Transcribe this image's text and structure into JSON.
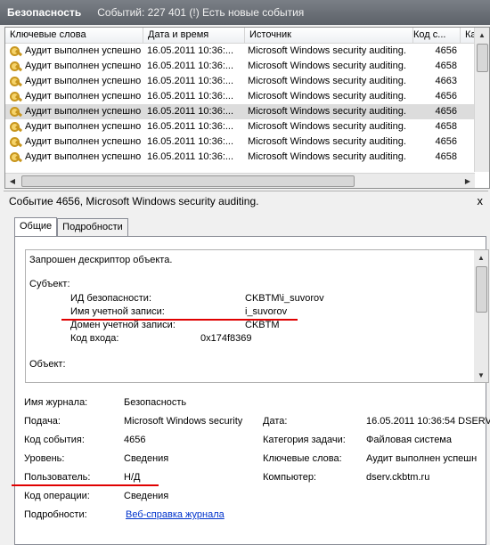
{
  "window": {
    "title": "Безопасность",
    "events_info": "Событий: 227 401 (!) Есть новые события"
  },
  "columns": [
    "Ключевые слова",
    "Дата и время",
    "Источник",
    "Код с...",
    "Ка"
  ],
  "rows": [
    {
      "keyword": "Аудит выполнен успешно",
      "date": "16.05.2011 10:36:...",
      "source": "Microsoft Windows security auditing.",
      "code": "4656"
    },
    {
      "keyword": "Аудит выполнен успешно",
      "date": "16.05.2011 10:36:...",
      "source": "Microsoft Windows security auditing.",
      "code": "4658"
    },
    {
      "keyword": "Аудит выполнен успешно",
      "date": "16.05.2011 10:36:...",
      "source": "Microsoft Windows security auditing.",
      "code": "4663"
    },
    {
      "keyword": "Аудит выполнен успешно",
      "date": "16.05.2011 10:36:...",
      "source": "Microsoft Windows security auditing.",
      "code": "4656"
    },
    {
      "keyword": "Аудит выполнен успешно",
      "date": "16.05.2011 10:36:...",
      "source": "Microsoft Windows security auditing.",
      "code": "4656"
    },
    {
      "keyword": "Аудит выполнен успешно",
      "date": "16.05.2011 10:36:...",
      "source": "Microsoft Windows security auditing.",
      "code": "4658"
    },
    {
      "keyword": "Аудит выполнен успешно",
      "date": "16.05.2011 10:36:...",
      "source": "Microsoft Windows security auditing.",
      "code": "4656"
    },
    {
      "keyword": "Аудит выполнен успешно",
      "date": "16.05.2011 10:36:...",
      "source": "Microsoft Windows security auditing.",
      "code": "4658"
    }
  ],
  "selected_row": 4,
  "detail": {
    "title": "Событие 4656, Microsoft Windows security auditing.",
    "close": "x",
    "tabs": [
      "Общие",
      "Подробности"
    ],
    "message": {
      "line1": "Запрошен дескриптор объекта.",
      "subject_label": "Субъект:",
      "sid_label": "ИД безопасности:",
      "sid_value": "CKBTM\\i_suvorov",
      "account_label": "Имя учетной записи:",
      "account_value": "i_suvorov",
      "domain_label": "Домен учетной записи:",
      "domain_value": "CKBTM",
      "logon_label": "Код входа:",
      "logon_value": "0x174f8369",
      "object_label": "Объект:"
    },
    "props": {
      "log_name_label": "Имя журнала:",
      "log_name": "Безопасность",
      "source_label": "Подача:",
      "source": "Microsoft Windows security",
      "date_label": "Дата:",
      "date": "16.05.2011 10:36:54 DSERV",
      "event_id_label": "Код события:",
      "event_id": "4656",
      "task_label": "Категория задачи:",
      "task": "Файловая система",
      "level_label": "Уровень:",
      "level": "Сведения",
      "keywords_label": "Ключевые слова:",
      "keywords": "Аудит выполнен успешн",
      "user_label": "Пользователь:",
      "user": "Н/Д",
      "computer_label": "Компьютер:",
      "computer": "dserv.ckbtm.ru",
      "opcode_label": "Код операции:",
      "opcode": "Сведения",
      "more_label": "Подробности:",
      "more_link": "Веб-справка журнала"
    }
  },
  "colors": {
    "accent_line": "#e00000",
    "link": "#0033cc"
  }
}
